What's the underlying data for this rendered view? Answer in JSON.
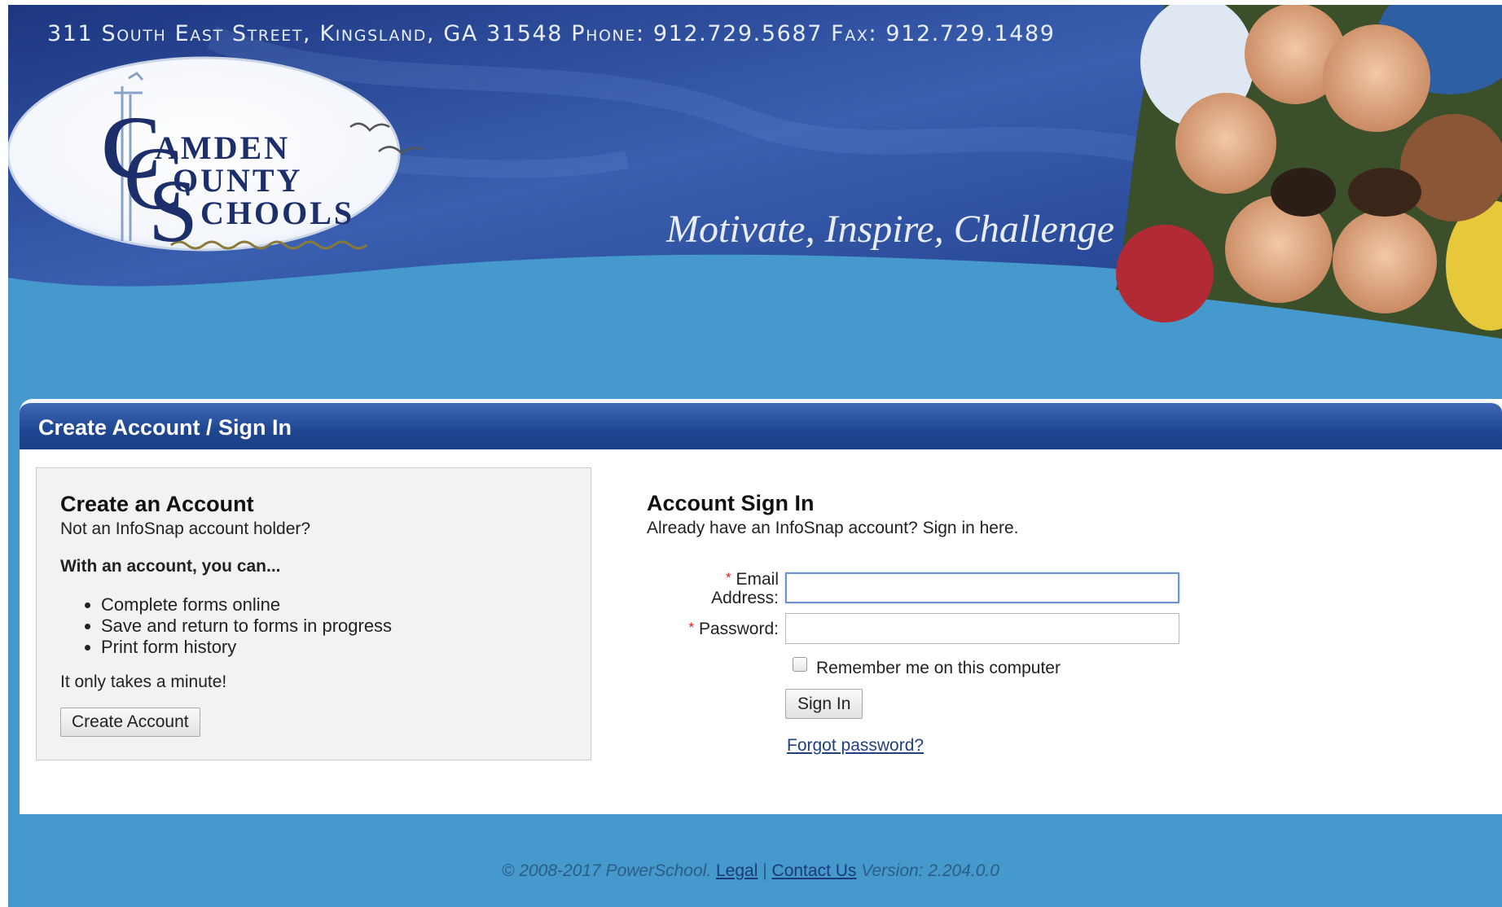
{
  "header": {
    "address": "311 South East Street, Kingsland, GA 31548   Phone: 912.729.5687   Fax: 912.729.1489",
    "tagline": "Motivate, Inspire, Challenge",
    "logo": {
      "line1": "AMDEN",
      "line2": "OUNTY",
      "line3": "CHOOLS",
      "initials": "CCS"
    }
  },
  "panel": {
    "title": "Create Account / Sign In"
  },
  "create": {
    "heading": "Create an Account",
    "subtext": "Not an InfoSnap account holder?",
    "benefits_heading": "With an account, you can...",
    "benefits": [
      "Complete forms online",
      "Save and return to forms in progress",
      "Print form history"
    ],
    "note": "It only takes a minute!",
    "button_label": "Create Account"
  },
  "signin": {
    "heading": "Account Sign In",
    "subtext": "Already have an InfoSnap account? Sign in here.",
    "required_mark": "*",
    "email_label_line1": "Email",
    "email_label_line2": "Address:",
    "email_value": "",
    "password_label": "Password:",
    "password_value": "",
    "remember_label": "Remember me on this computer",
    "remember_checked": false,
    "button_label": "Sign In",
    "forgot_label": "Forgot password?"
  },
  "footer": {
    "copyright": "© 2008-2017 PowerSchool.",
    "legal_label": "Legal",
    "separator": "|",
    "contact_label": "Contact Us",
    "version": "Version: 2.204.0.0"
  },
  "colors": {
    "page_background": "#4599cc",
    "banner_dark_blue": "#1f3c8a",
    "panel_header_blue": "#1f4690",
    "required_red": "#d21a1a",
    "link_blue": "#22407f"
  }
}
